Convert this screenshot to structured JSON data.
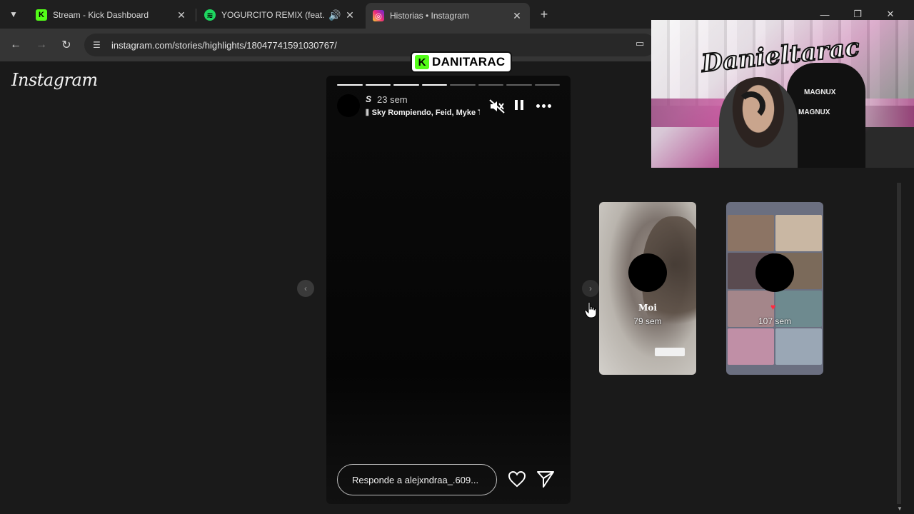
{
  "browser": {
    "tabs": [
      {
        "title": "Stream - Kick Dashboard",
        "favicon": "kick-icon",
        "active": false
      },
      {
        "title": "YOGURCITO REMIX (feat. Kr",
        "favicon": "spotify-icon",
        "active": false,
        "audio": true
      },
      {
        "title": "Historias • Instagram",
        "favicon": "instagram-icon",
        "active": true
      }
    ],
    "url": "instagram.com/stories/highlights/18047741591030767/"
  },
  "instagram": {
    "logo": "Instagram",
    "story": {
      "progress_total": 8,
      "progress_done": 4,
      "user_glyph": "S",
      "time": "23 sem",
      "music": "Sky Rompiendo, Feid, Myke Towers",
      "reply_placeholder": "Responde a alejxndraa_.609..."
    },
    "next_highlights": [
      {
        "title": "Moi",
        "time": "79 sem"
      },
      {
        "title": "",
        "time": "107 sem"
      }
    ]
  },
  "overlay": {
    "kick_channel": "DANITARAC",
    "webcam_graffiti": "Danieltarac",
    "chair_brand": "MAGNUX"
  },
  "colors": {
    "kick_green": "#53fc18",
    "spotify_green": "#1ed760",
    "instagram_gradient": "#e1306c"
  }
}
